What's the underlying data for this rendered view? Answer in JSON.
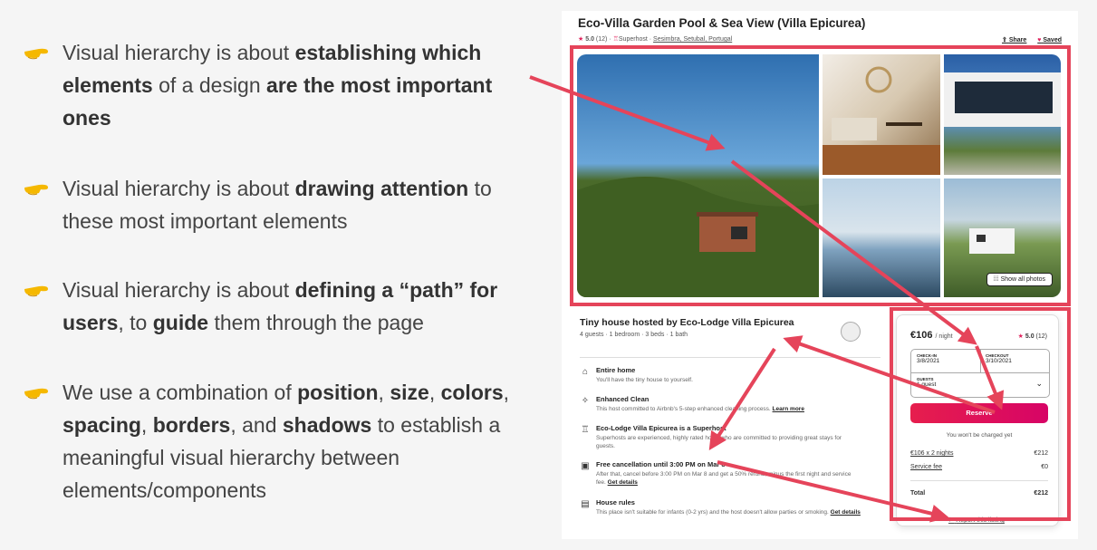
{
  "slide": {
    "bullets": [
      {
        "parts": [
          {
            "t": "Visual hierarchy is about "
          },
          {
            "t": "establishing which elements",
            "b": true
          },
          {
            "t": " of a design "
          },
          {
            "t": "are the most important ones",
            "b": true
          }
        ]
      },
      {
        "parts": [
          {
            "t": "Visual hierarchy is about "
          },
          {
            "t": "drawing attention",
            "b": true
          },
          {
            "t": " to these most important elements"
          }
        ]
      },
      {
        "parts": [
          {
            "t": "Visual hierarchy is about "
          },
          {
            "t": "defining a “path” for users",
            "b": true
          },
          {
            "t": ", to "
          },
          {
            "t": "guide",
            "b": true
          },
          {
            "t": " them through the page"
          }
        ]
      },
      {
        "parts": [
          {
            "t": "We use a combination of "
          },
          {
            "t": "position",
            "b": true
          },
          {
            "t": ", "
          },
          {
            "t": "size",
            "b": true
          },
          {
            "t": ", "
          },
          {
            "t": "colors",
            "b": true
          },
          {
            "t": ", "
          },
          {
            "t": "spacing",
            "b": true
          },
          {
            "t": ", "
          },
          {
            "t": "borders",
            "b": true
          },
          {
            "t": ", and "
          },
          {
            "t": "shadows",
            "b": true
          },
          {
            "t": " to establish a meaningful visual hierarchy between elements/components"
          }
        ]
      }
    ],
    "bullet_icon": "pointing-hand-icon",
    "annotation_color": "#e5445a"
  },
  "listing": {
    "title": "Eco-Villa Garden Pool & Sea View (Villa Epicurea)",
    "rating": "5.0",
    "reviews": "(12)",
    "superhost": "Superhost",
    "location": "Sesimbra, Setubal, Portugal",
    "share": "Share",
    "saved": "Saved",
    "show_all_photos": "Show all photos",
    "host_title": "Tiny house hosted by Eco-Lodge Villa Epicurea",
    "host_sub": "4 guests · 1 bedroom · 3 beds · 1 bath",
    "features": [
      {
        "icon": "home-icon",
        "glyph": "⌂",
        "title": "Entire home",
        "desc": "You'll have the tiny house to yourself.",
        "link": ""
      },
      {
        "icon": "sparkle-icon",
        "glyph": "✧",
        "title": "Enhanced Clean",
        "desc": "This host committed to Airbnb's 5-step enhanced cleaning process.",
        "link": "Learn more"
      },
      {
        "icon": "medal-icon",
        "glyph": "♖",
        "title": "Eco-Lodge Villa Epicurea is a Superhost",
        "desc": "Superhosts are experienced, highly rated hosts who are committed to providing great stays for guests.",
        "link": ""
      },
      {
        "icon": "calendar-icon",
        "glyph": "▣",
        "title": "Free cancellation until 3:00 PM on Mar 8",
        "desc": "After that, cancel before 3:00 PM on Mar 8 and get a 50% refund, minus the first night and service fee.",
        "link": "Get details"
      },
      {
        "icon": "book-icon",
        "glyph": "▤",
        "title": "House rules",
        "desc": "This place isn't suitable for infants (0-2 yrs) and the host doesn't allow parties or smoking.",
        "link": "Get details"
      }
    ],
    "booking": {
      "price": "€106",
      "per": "/ night",
      "rating": "5.0",
      "reviews": "(12)",
      "checkin_label": "CHECK-IN",
      "checkin": "3/8/2021",
      "checkout_label": "CHECKOUT",
      "checkout": "3/10/2021",
      "guests_label": "GUESTS",
      "guests": "1 guest",
      "reserve": "Reserve",
      "note": "You won't be charged yet",
      "nights_label": "€106 x 2 nights",
      "nights_value": "€212",
      "fee_label": "Service fee",
      "fee_value": "€0",
      "total_label": "Total",
      "total_value": "€212"
    },
    "report": "Report this listing"
  }
}
